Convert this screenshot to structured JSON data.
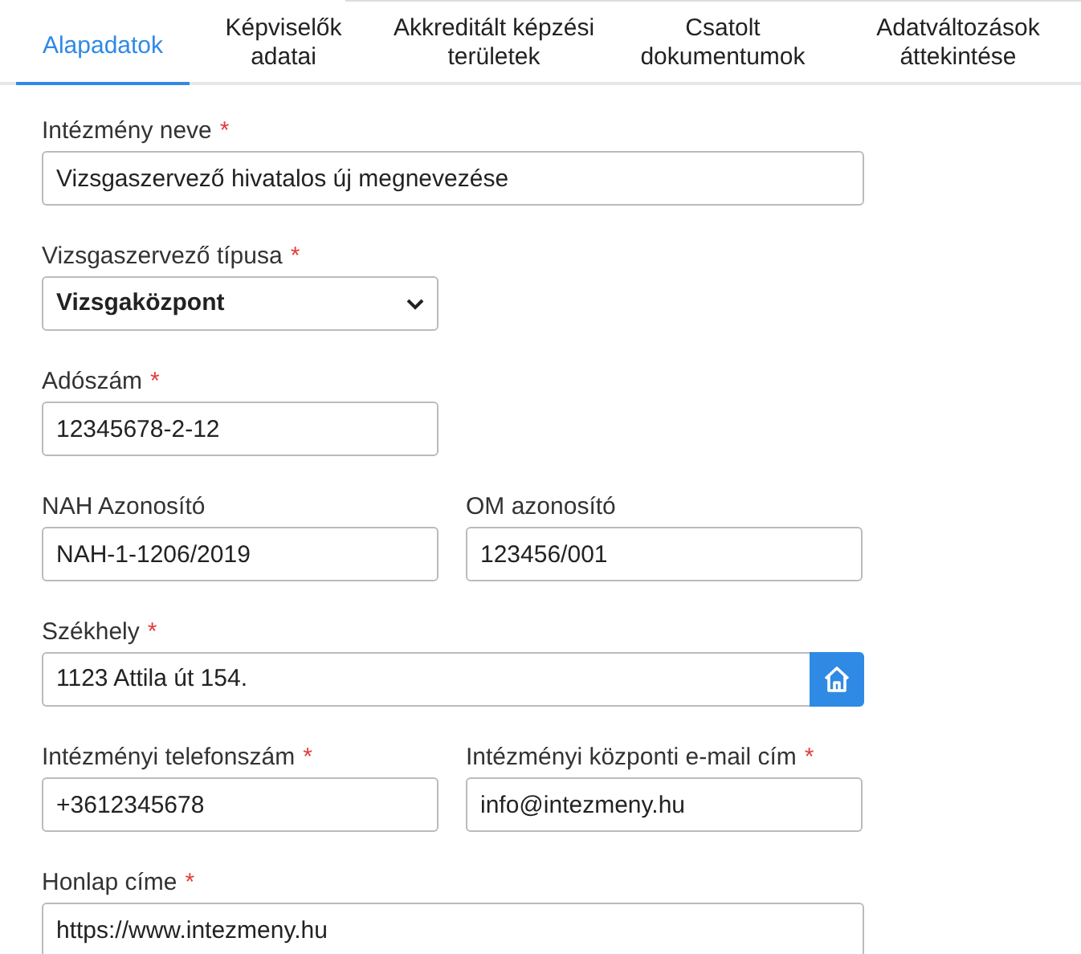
{
  "tabs": [
    {
      "label": "Alapadatok",
      "selected": true
    },
    {
      "label": "Képviselők adatai",
      "selected": false
    },
    {
      "label": "Akkreditált képzési területek",
      "selected": false
    },
    {
      "label": "Csatolt dokumentumok",
      "selected": false
    },
    {
      "label": "Adatváltozások áttekintése",
      "selected": false
    }
  ],
  "form_rows": [
    [
      {
        "kind": "wide_text",
        "label": "Intézmény neve",
        "required_mark": "*",
        "value": "Vizsgaszervező hivatalos új megnevezése"
      }
    ],
    [
      {
        "kind": "select",
        "label": "Vizsgaszervező típusa",
        "required_mark": "*",
        "value": "Vizsgaközpont"
      }
    ],
    [
      {
        "kind": "text",
        "label": "Adószám",
        "required_mark": "*",
        "value": "12345678-2-12"
      }
    ],
    [
      {
        "kind": "text",
        "label": "NAH Azonosító",
        "value": "NAH-1-1206/2019"
      },
      {
        "kind": "text",
        "label": "OM azonosító",
        "value": "123456/001"
      }
    ],
    [
      {
        "kind": "address",
        "label": "Székhely",
        "required_mark": "*",
        "value": "1123 Attila út 154."
      }
    ],
    [
      {
        "kind": "text",
        "label": "Intézményi telefonszám",
        "required_mark": "*",
        "value": "+3612345678"
      },
      {
        "kind": "text",
        "label": "Intézményi központi e-mail cím",
        "required_mark": "*",
        "value": "info@intezmeny.hu"
      }
    ],
    [
      {
        "kind": "wide_text",
        "label": "Honlap címe",
        "required_mark": "*",
        "value": "https://www.intezmeny.hu"
      }
    ]
  ]
}
